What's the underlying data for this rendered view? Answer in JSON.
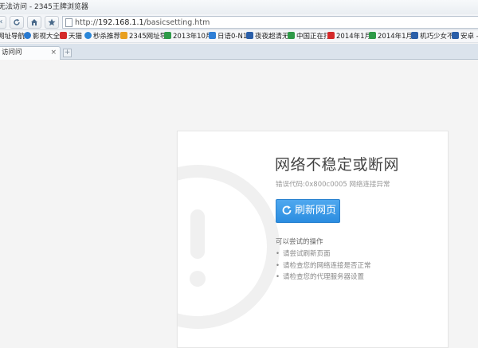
{
  "window": {
    "title": "无法访问 - 2345王牌浏览器"
  },
  "navbar": {
    "url_prefix": "http://",
    "url_host": "192.168.1.1",
    "url_path": "/basicsetting.htm"
  },
  "bookmarks": [
    {
      "label": "网址导航",
      "icon": "nav-icon",
      "color": "#2f7fd6"
    },
    {
      "label": "影视大全",
      "icon": "video-icon",
      "color": "#2a7ad0"
    },
    {
      "label": "天猫",
      "icon": "tmall-icon",
      "color": "#d42a2a"
    },
    {
      "label": "秒杀推荐",
      "icon": "flash-sale-icon",
      "color": "#2a86d8"
    },
    {
      "label": "2345网址导",
      "icon": "site-2345-icon",
      "color": "#e8a020"
    },
    {
      "label": "2013年10月",
      "icon": "folder-icon",
      "color": "#2f9a48"
    },
    {
      "label": "日语0-N1",
      "icon": "doc-icon",
      "color": "#2f7fd6"
    },
    {
      "label": "夜夜超清无",
      "icon": "image-icon",
      "color": "#2b5fa8"
    },
    {
      "label": "中国正在打",
      "icon": "news-icon",
      "color": "#2f9a48"
    },
    {
      "label": "2014年1月",
      "icon": "le-icon",
      "color": "#d42a2a"
    },
    {
      "label": "2014年1月",
      "icon": "folder-icon",
      "color": "#2f9a48"
    },
    {
      "label": "机巧少女不",
      "icon": "image-icon",
      "color": "#2b5fa8"
    },
    {
      "label": "安卓 -",
      "icon": "image-icon",
      "color": "#2b5fa8"
    }
  ],
  "tabs": [
    {
      "label": "访问问",
      "close": "×"
    }
  ],
  "newtab": "+",
  "error": {
    "title": "网络不稳定或断网",
    "code": "错误代码:0x800c0005 网络连接异常",
    "refresh_label": "刷新网页",
    "try_title": "可以尝试的操作",
    "tips": [
      "请尝试刷新页面",
      "请检查您的网络连接是否正常",
      "请检查您的代理服务器设置"
    ]
  },
  "colors": {
    "accent": "#2b8de0",
    "title_text": "#444444"
  }
}
